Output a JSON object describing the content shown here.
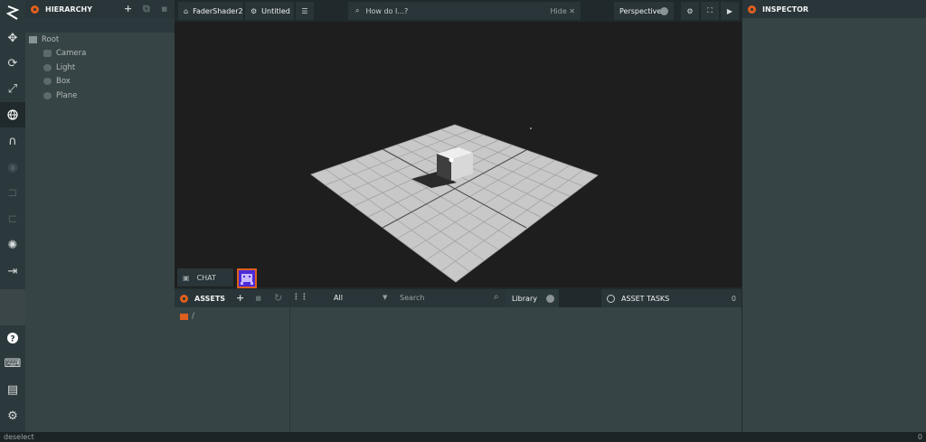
{
  "toolbar": {
    "logo": "logo-icon",
    "tools": [
      "move-icon",
      "rotate-icon",
      "scale-icon",
      "world-icon",
      "magnet-icon",
      "eye-icon",
      "resize-icon",
      "frame-icon",
      "light-icon",
      "exit-icon",
      "help-icon",
      "keyboard-icon",
      "chat-icon",
      "settings-icon"
    ]
  },
  "hierarchy": {
    "title": "HIERARCHY",
    "items": [
      {
        "label": "Root",
        "icon": "folder-icon"
      },
      {
        "label": "Camera",
        "icon": "camera-icon"
      },
      {
        "label": "Light",
        "icon": "bulb-icon"
      },
      {
        "label": "Box",
        "icon": "model-icon"
      },
      {
        "label": "Plane",
        "icon": "model-icon"
      }
    ]
  },
  "topbar": {
    "project": "FaderShader2",
    "scene": "Untitled",
    "search_placeholder": "How do I...?",
    "hide_label": "Hide",
    "camera": "Perspective"
  },
  "chat": {
    "label": "CHAT"
  },
  "assets": {
    "title": "ASSETS",
    "filter": "All",
    "search_placeholder": "Search",
    "library_label": "Library",
    "path": "/"
  },
  "asset_tasks": {
    "title": "ASSET TASKS",
    "count": "0"
  },
  "inspector": {
    "title": "INSPECTOR"
  },
  "statusbar": {
    "text": "deselect",
    "count": "0"
  },
  "colors": {
    "accent": "#e05f1e",
    "panel": "#374446",
    "header": "#293538",
    "viewport": "#1e1e1e"
  }
}
